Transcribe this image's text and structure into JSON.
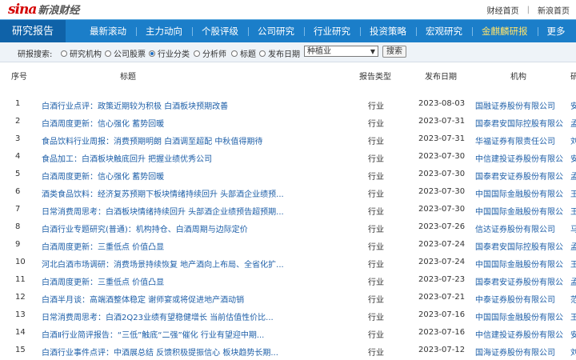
{
  "header": {
    "logo_sina": "sina",
    "logo_cn": "新浪财经",
    "top_links": [
      "财经首页",
      "新浪首页"
    ],
    "separator": "|"
  },
  "nav": {
    "section": "研究报告",
    "items": [
      "最新滚动",
      "主力动向",
      "个股评级",
      "公司研究",
      "行业研究",
      "投资策略",
      "宏观研究",
      "金麒麟研报",
      "更多"
    ]
  },
  "search": {
    "label": "研报搜索:",
    "options": [
      "研究机构",
      "公司股票",
      "行业分类",
      "分析师",
      "标题",
      "发布日期"
    ],
    "selected_option": "行业分类",
    "select_value": "种植业",
    "button": "搜索"
  },
  "table": {
    "headers": [
      "序号",
      "标题",
      "报告类型",
      "发布日期",
      "机构",
      "研"
    ],
    "rows": [
      {
        "no": "1",
        "title": "白酒行业点评：政策近期较为积极 白酒板块预期改善",
        "type": "行业",
        "date": "2023-08-03",
        "org": "国融证券股份有限公司",
        "extra": "安"
      },
      {
        "no": "2",
        "title": "白酒周度更新：信心强化 蓄势回暖",
        "type": "行业",
        "date": "2023-07-31",
        "org": "国泰君安国际控股有限公司",
        "extra": "孟"
      },
      {
        "no": "3",
        "title": "食品饮料行业周报：消费预期明朗 白酒调至超配 中秋值得期待",
        "type": "行业",
        "date": "2023-07-31",
        "org": "华福证券有限责任公司",
        "extra": "刘"
      },
      {
        "no": "4",
        "title": "食品加工：白酒板块触底回升 把握业绩优秀公司",
        "type": "行业",
        "date": "2023-07-30",
        "org": "中信建投证券股份有限公司",
        "extra": "安"
      },
      {
        "no": "5",
        "title": "白酒周度更新：信心强化 蓄势回暖",
        "type": "行业",
        "date": "2023-07-30",
        "org": "国泰君安证券股份有限公司",
        "extra": "孟"
      },
      {
        "no": "6",
        "title": "酒类食品饮料：经济复苏预期下板块情绪持续回升 头部酒企业绩预...",
        "type": "行业",
        "date": "2023-07-30",
        "org": "中国国际金融股份有限公司",
        "extra": "王"
      },
      {
        "no": "7",
        "title": "日常消费周思考：白酒板块情绪持续回升 头部酒企业绩预告超预期...",
        "type": "行业",
        "date": "2023-07-30",
        "org": "中国国际金融股份有限公司",
        "extra": "王"
      },
      {
        "no": "8",
        "title": "白酒行业专题研究(普通)：机构持仓、白酒周期与边际定价",
        "type": "行业",
        "date": "2023-07-26",
        "org": "信达证券股份有限公司",
        "extra": "马"
      },
      {
        "no": "9",
        "title": "白酒周度更新：三重低点 价值凸显",
        "type": "行业",
        "date": "2023-07-24",
        "org": "国泰君安国际控股有限公司",
        "extra": "孟"
      },
      {
        "no": "10",
        "title": "河北白酒市场调研：消费场景持续恢复 地产酒向上布局、全省化扩...",
        "type": "行业",
        "date": "2023-07-24",
        "org": "中国国际金融股份有限公司",
        "extra": "王"
      },
      {
        "no": "11",
        "title": "白酒周度更新：三重低点 价值凸显",
        "type": "行业",
        "date": "2023-07-23",
        "org": "国泰君安证券股份有限公司",
        "extra": "孟"
      },
      {
        "no": "12",
        "title": "白酒半月谈：高端酒整体稳定 谢师宴或将促进地产酒动销",
        "type": "行业",
        "date": "2023-07-21",
        "org": "中泰证券股份有限公司",
        "extra": "范"
      },
      {
        "no": "13",
        "title": "日常消费周思考：白酒2Q23业绩有望稳健增长 当前估值性价比...",
        "type": "行业",
        "date": "2023-07-16",
        "org": "中国国际金融股份有限公司",
        "extra": "王"
      },
      {
        "no": "14",
        "title": "白酒Ⅱ行业简评报告：“三低”触底“二强”催化 行业有望迎中期...",
        "type": "行业",
        "date": "2023-07-16",
        "org": "中信建投证券股份有限公司",
        "extra": "安"
      },
      {
        "no": "15",
        "title": "白酒行业事件点评：中酒展总结 反馈积极提振信心 板块趋势长期...",
        "type": "行业",
        "date": "2023-07-12",
        "org": "国海证券股份有限公司",
        "extra": "刘"
      }
    ]
  }
}
